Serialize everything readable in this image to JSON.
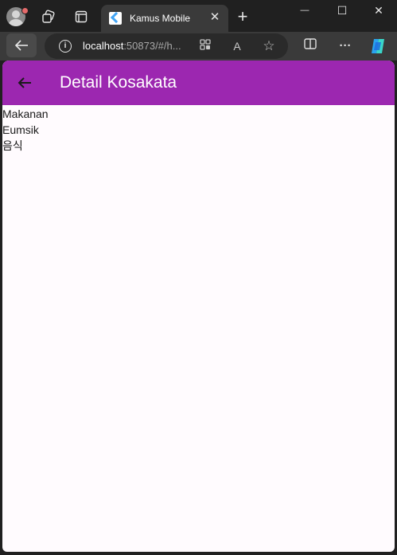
{
  "browser": {
    "tab": {
      "title": "Kamus Mobile",
      "close_glyph": "✕"
    },
    "new_tab_glyph": "+",
    "window_controls": {
      "minimize": "—",
      "maximize": "☐",
      "close": "✕"
    },
    "address": {
      "host": "localhost",
      "rest": ":50873/#/h...",
      "info_glyph": "i"
    },
    "icons": {
      "tab_actions": "tab-actions-icon",
      "workspaces": "workspaces-icon",
      "tabs": "vertical-tabs-icon",
      "back": "back-arrow-icon",
      "apps": "apps-icon",
      "read_aloud": "read-aloud-icon",
      "favorite": "star-icon",
      "split": "split-screen-icon",
      "more": "more-icon",
      "copilot": "copilot-icon"
    },
    "read_aloud_glyph": "A",
    "favorite_glyph": "☆",
    "more_glyph": "···"
  },
  "app": {
    "title": "Detail Kosakata",
    "accent_color": "#9c27b0",
    "detail": {
      "indonesian": "Makanan",
      "romanization": "Eumsik",
      "korean": "음식"
    }
  }
}
